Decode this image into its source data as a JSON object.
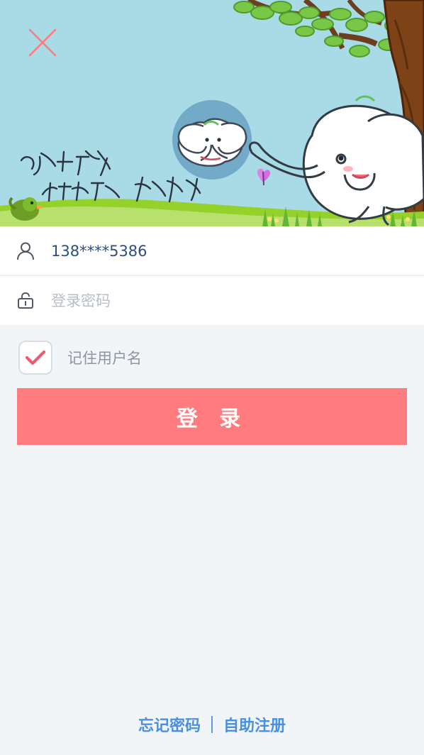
{
  "header": {
    "close_icon": "close-icon",
    "banner_graphic": "elephant-tree-banner",
    "avatar_icon": "elephant-avatar-icon"
  },
  "login_form": {
    "username_value": "138****5386",
    "password_placeholder": "登录密码",
    "user_icon": "user-icon",
    "lock_icon": "lock-icon"
  },
  "remember": {
    "label": "记住用户名",
    "checked": true
  },
  "actions": {
    "login_label": "登 录"
  },
  "footer": {
    "forgot_password": "忘记密码",
    "register": "自助注册"
  },
  "colors": {
    "accent": "#ff7b7d",
    "link": "#4a90e2",
    "background": "#f1f5f8",
    "checkmark": "#ee5a6f"
  }
}
